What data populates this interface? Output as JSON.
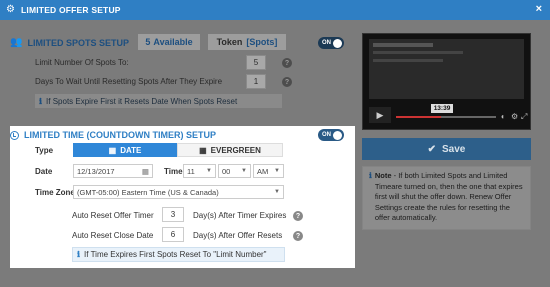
{
  "window": {
    "title": "LIMITED OFFER SETUP",
    "close": "×"
  },
  "spots": {
    "title": "LIMITED SPOTS SETUP",
    "available_count": "5",
    "available_label": "Available",
    "token_label": "Token",
    "token_value": "[Spots]",
    "toggle": "ON",
    "limit_label": "Limit Number Of Spots To:",
    "limit_value": "5",
    "wait_label": "Days To Wait Until Resetting Spots After They Expire",
    "wait_value": "1",
    "note": "If Spots Expire First it Resets Date When Spots Reset"
  },
  "timer": {
    "title": "LIMITED TIME (COUNTDOWN TIMER) SETUP",
    "toggle": "ON",
    "type_label": "Type",
    "type_date": "DATE",
    "type_evergreen": "EVERGREEN",
    "date_label": "Date",
    "date_value": "12/13/2017",
    "time_label": "Time",
    "hour": "11",
    "minute": "00",
    "ampm": "AM",
    "zone_label": "Time Zone",
    "zone_value": "(GMT-05:00) Eastern Time (US & Canada)",
    "auto_reset_label": "Auto Reset Offer Timer",
    "auto_reset_value": "3",
    "auto_reset_suffix": "Day(s) After Timer Expires",
    "close_date_label": "Auto Reset Close Date",
    "close_date_value": "6",
    "close_date_suffix": "Day(s) After Offer Resets",
    "note": "If Time Expires First Spots Reset To \"Limit Number\""
  },
  "video": {
    "timestamp": "13:39",
    "progress": 0.45
  },
  "save_label": "Save",
  "info_note_label": "Note",
  "info_note_text": "- If both Limited Spots and Limited Timeare turned on, then the one that expires first will shut the offer down. Renew Offer Settings create the rules for resetting the offer automatically.",
  "help_glyph": "?"
}
